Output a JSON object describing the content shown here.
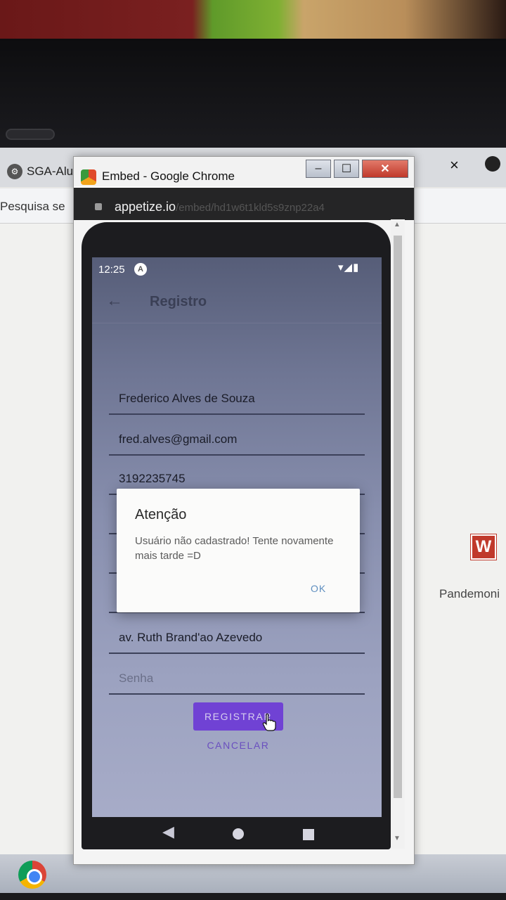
{
  "background_browser": {
    "tab_title": "SGA-Alu",
    "bookmark": "Pesquisa se",
    "close_glyph": "×",
    "side_label": "Pandemoni",
    "side_icon_letter": "W"
  },
  "embed_window": {
    "title": "Embed - Google Chrome",
    "url_host": "appetize.io",
    "url_path": "/embed/hd1w6t1kld5s9znp22a4",
    "minimize_glyph": "–",
    "maximize_glyph": "☐",
    "close_glyph": "✕"
  },
  "phone": {
    "status": {
      "time": "12:25",
      "notification_letter": "A",
      "icons": "▾◢▮"
    },
    "appbar": {
      "back_glyph": "←",
      "title": "Registro"
    },
    "form_fields": [
      {
        "value": "Frederico Alves de Souza",
        "placeholder": false
      },
      {
        "value": "fred.alves@gmail.com",
        "placeholder": false
      },
      {
        "value": "3192235745",
        "placeholder": false
      },
      {
        "value": "",
        "placeholder": false
      },
      {
        "value": "",
        "placeholder": false
      },
      {
        "value": "",
        "placeholder": false
      },
      {
        "value": "av. Ruth Brand'ao Azevedo",
        "placeholder": false
      },
      {
        "value": "Senha",
        "placeholder": true
      }
    ],
    "buttons": {
      "register": "REGISTRAR",
      "cancel": "CANCELAR"
    },
    "dialog": {
      "title": "Atenção",
      "message": "Usuário não cadastrado! Tente novamente mais tarde =D",
      "ok": "OK"
    },
    "nav": {
      "back_glyph": "◀"
    }
  },
  "colors": {
    "primary_button": "#7042d4",
    "cancel_text": "#6a4fbf",
    "dialog_ok": "#5f8fc0",
    "close_button": "#c0392b"
  }
}
